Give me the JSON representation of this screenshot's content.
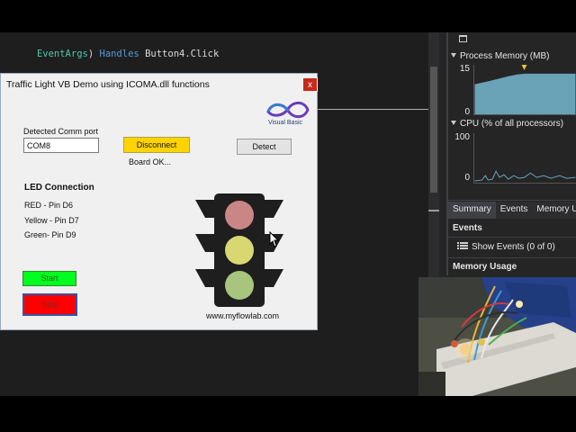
{
  "editor": {
    "code_tokens": [
      {
        "text": "EventArgs",
        "kind": "type"
      },
      {
        "text": ") ",
        "kind": "plain"
      },
      {
        "text": "Handles",
        "kind": "kw"
      },
      {
        "text": " Button4.Click",
        "kind": "plain"
      }
    ]
  },
  "diagnostics": {
    "memory": {
      "title": "Process Memory (MB)",
      "y_max": "15",
      "y_min": "0"
    },
    "cpu": {
      "title": "CPU (% of all processors)",
      "y_max": "100",
      "y_min": "0"
    },
    "tabs": [
      "Summary",
      "Events",
      "Memory U"
    ],
    "events_heading": "Events",
    "show_events": "Show Events (0 of 0)",
    "memory_usage_heading": "Memory Usage"
  },
  "dialog": {
    "title": "Traffic Light VB Demo using ICOMA.dll functions",
    "close_glyph": "x",
    "logo_text": "Visual Basic",
    "port_label": "Detected Comm port",
    "port_value": "COM8",
    "disconnect_label": "Disconnect",
    "detect_label": "Detect",
    "board_status": "Board OK...",
    "led_heading": "LED Connection",
    "pins": [
      "RED - Pin D6",
      "Yellow - Pin D7",
      "Green- Pin D9"
    ],
    "start_label": "Start",
    "stop_label": "Stop",
    "website": "www.myflowlab.com"
  },
  "colors": {
    "red_lamp": "#c98684",
    "yellow_lamp": "#d8d772",
    "green_lamp": "#a7c57d",
    "start_button": "#00ff1e",
    "stop_button": "#ff0000",
    "disconnect_button": "#ffd400"
  }
}
